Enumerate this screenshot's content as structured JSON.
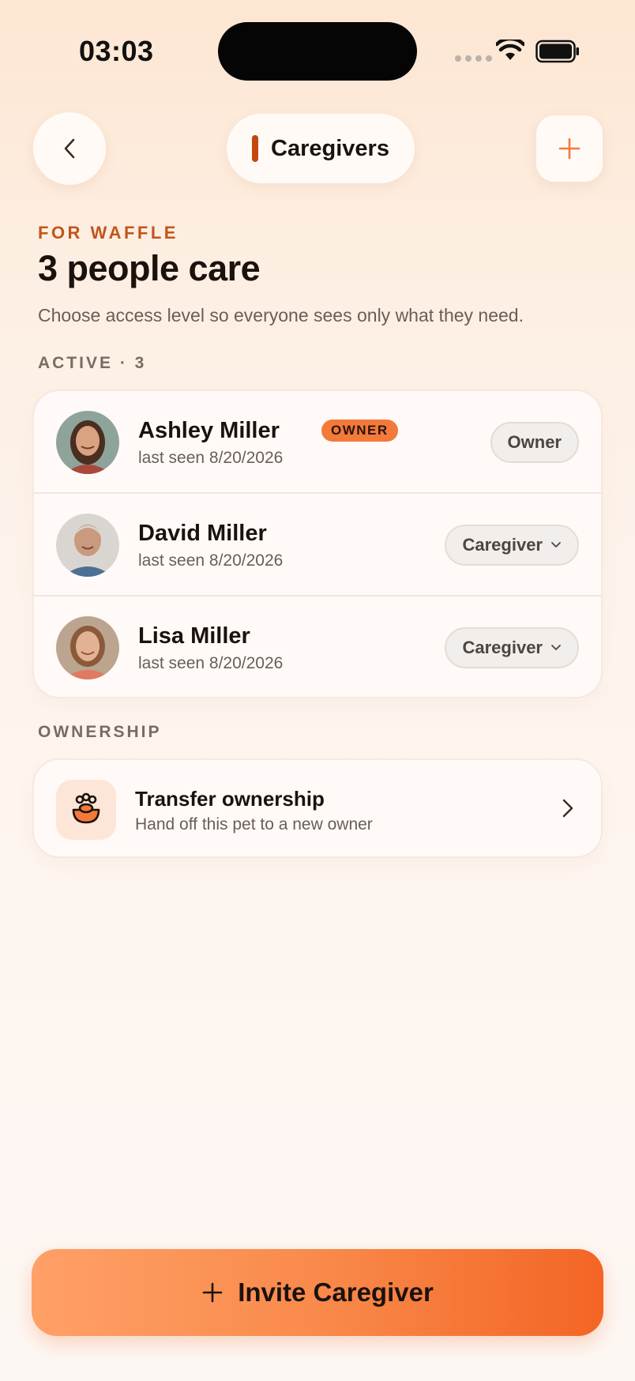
{
  "status_bar": {
    "time": "03:03"
  },
  "header": {
    "title": "Caregivers"
  },
  "intro": {
    "eyebrow": "FOR WAFFLE",
    "headline": "3 people care",
    "subtitle": "Choose access level so everyone sees only what they need."
  },
  "active_section": {
    "label": "ACTIVE · 3",
    "members": [
      {
        "name": "Ashley Miller",
        "badge": "OWNER",
        "last_seen": "last seen 8/20/2026",
        "role": "Owner"
      },
      {
        "name": "David Miller",
        "last_seen": "last seen 8/20/2026",
        "role": "Caregiver"
      },
      {
        "name": "Lisa Miller",
        "last_seen": "last seen 8/20/2026",
        "role": "Caregiver"
      }
    ]
  },
  "ownership_section": {
    "label": "OWNERSHIP",
    "title": "Transfer ownership",
    "subtitle": "Hand off this pet to a new owner"
  },
  "invite_button": {
    "label": "Invite Caregiver"
  },
  "colors": {
    "accent": "#f37a3a",
    "accent_dark": "#c4470f",
    "background": "#fdf4ec"
  }
}
